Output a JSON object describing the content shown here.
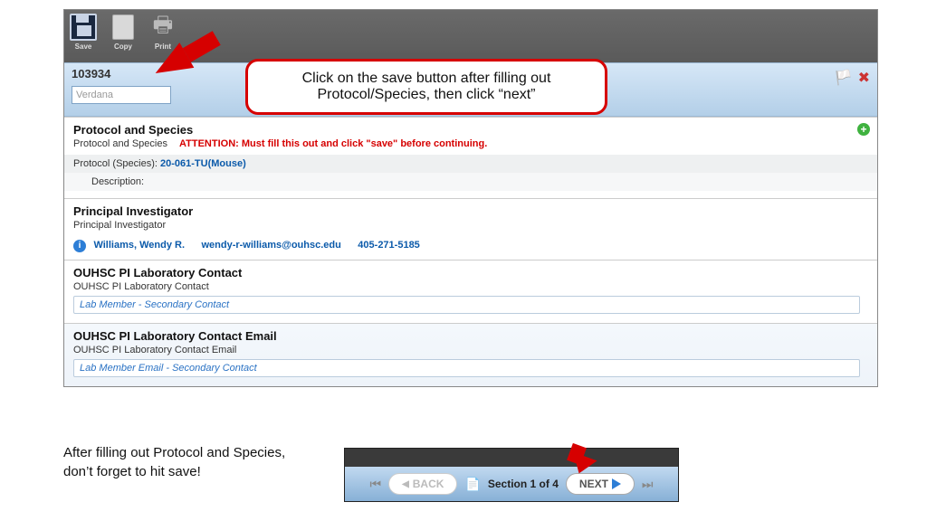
{
  "toolbar": {
    "save_label": "Save",
    "copy_label": "Copy",
    "print_label": "Print"
  },
  "header": {
    "id": "103934",
    "font_value": "Verdana"
  },
  "callout": {
    "line1": "Click on the save button after filling out",
    "line2": "Protocol/Species, then click “next”"
  },
  "sections": {
    "ps": {
      "title": "Protocol and Species",
      "sub": "Protocol and Species",
      "attn": "ATTENTION: Must fill this out and click \"save\" before continuing.",
      "proto_label": "Protocol (Species):",
      "proto_value": "20-061-TU(Mouse)",
      "desc_label": "Description:"
    },
    "pi": {
      "title": "Principal Investigator",
      "sub": "Principal Investigator",
      "name": "Williams, Wendy R.",
      "email": "wendy-r-williams@ouhsc.edu",
      "phone": "405-271-5185"
    },
    "labc": {
      "title": "OUHSC PI Laboratory Contact",
      "sub": "OUHSC PI Laboratory Contact",
      "value": "Lab Member - Secondary Contact"
    },
    "labe": {
      "title": "OUHSC PI Laboratory Contact Email",
      "sub": "OUHSC PI Laboratory Contact Email",
      "value": "Lab Member Email - Secondary Contact"
    }
  },
  "caption": "After filling out Protocol and Species, don’t forget to hit save!",
  "nav": {
    "back": "BACK",
    "section": "Section 1 of 4",
    "next": "NEXT"
  }
}
